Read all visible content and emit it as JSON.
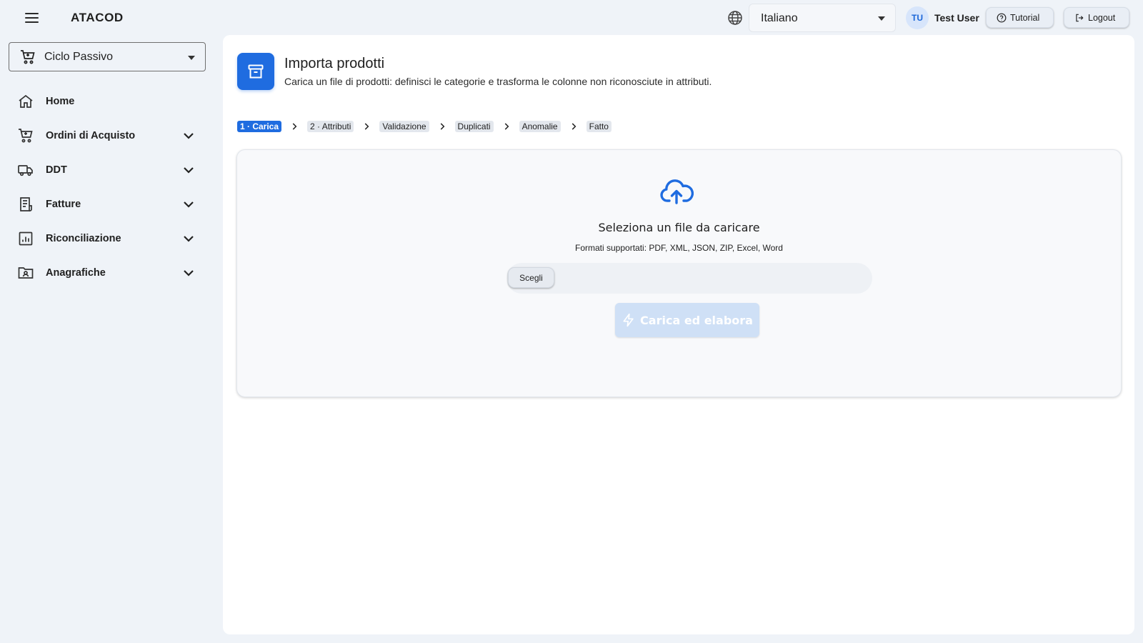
{
  "app": {
    "brand": "ATACOD"
  },
  "header": {
    "language": "Italiano",
    "user_initials": "TU",
    "user_name": "Test User",
    "tutorial_label": "Tutorial",
    "logout_label": "Logout"
  },
  "sidebar": {
    "cycle": "Ciclo Passivo",
    "items": [
      {
        "label": "Home",
        "icon": "home-icon",
        "expandable": false
      },
      {
        "label": "Ordini di Acquisto",
        "icon": "cart-icon",
        "expandable": true
      },
      {
        "label": "DDT",
        "icon": "truck-icon",
        "expandable": true
      },
      {
        "label": "Fatture",
        "icon": "receipt-icon",
        "expandable": true
      },
      {
        "label": "Riconciliazione",
        "icon": "chart-icon",
        "expandable": true
      },
      {
        "label": "Anagrafiche",
        "icon": "folder-user-icon",
        "expandable": true
      }
    ]
  },
  "page": {
    "title": "Importa prodotti",
    "subtitle": "Carica un file di prodotti: definisci le categorie e trasforma le colonne non riconosciute in attributi.",
    "steps": [
      "1 · Carica",
      "2 · Attributi",
      "Validazione",
      "Duplicati",
      "Anomalie",
      "Fatto"
    ],
    "active_step": 0
  },
  "upload": {
    "title": "Seleziona un file da caricare",
    "formats": "Formati supportati: PDF, XML, JSON, ZIP, Excel, Word",
    "choose_label": "Scegli",
    "submit_label": "Carica ed elabora",
    "submit_disabled": true
  },
  "colors": {
    "accent": "#1f6ce0",
    "background": "#eff3f8",
    "disabled_button": "#cfe0f6"
  }
}
